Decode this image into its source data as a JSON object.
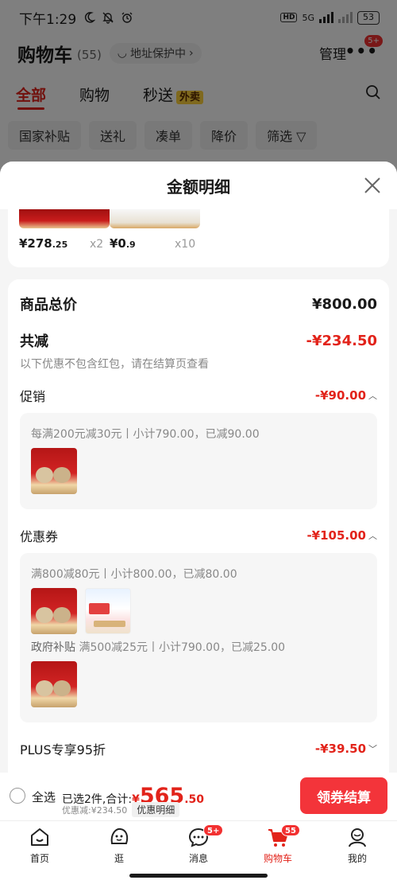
{
  "status_bar": {
    "time": "下午1:29",
    "hd": "HD",
    "network": "5G",
    "battery": "53"
  },
  "cart_header": {
    "title": "购物车",
    "count": "(55)",
    "address_protection": "地址保护中",
    "manage": "管理",
    "more_badge": "5+"
  },
  "tabs": [
    {
      "label": "全部",
      "active": true
    },
    {
      "label": "购物",
      "active": false
    },
    {
      "label": "秒送",
      "active": false,
      "tag": "外卖"
    }
  ],
  "filters": [
    "国家补贴",
    "送礼",
    "凑单",
    "降价",
    "筛选"
  ],
  "sheet": {
    "title": "金额明细",
    "items": [
      {
        "price_int": "¥278",
        "price_dec": ".25",
        "qty": "x2"
      },
      {
        "price_int": "¥0",
        "price_dec": ".9",
        "qty": "x10"
      }
    ],
    "total_label": "商品总价",
    "total_value": "¥800.00",
    "reduce_label": "共减",
    "reduce_value": "-¥234.50",
    "reduce_note": "以下优惠不包含红包，请在结算页查看",
    "promo_label": "促销",
    "promo_value": "-¥90.00",
    "promo_rule": "每满200元减30元丨小计790.00，已减90.00",
    "coupon_label": "优惠券",
    "coupon_value": "-¥105.00",
    "coupon_rule_1": "满800减80元丨小计800.00，已减80.00",
    "coupon_rule_2_tag": "政府补贴",
    "coupon_rule_2": " 满500减25元丨小计790.00，已减25.00",
    "plus_label": "PLUS专享95折",
    "plus_value": "-¥39.50"
  },
  "checkout": {
    "select_all": "全选",
    "selected_prefix": "已选2件,合计:",
    "yen": "¥",
    "total_int": "565",
    "total_dec": ".50",
    "discount_text": "优惠减:¥234.50",
    "detail_button": "优惠明细",
    "checkout_button": "领券结算"
  },
  "bottom_nav": [
    {
      "label": "首页",
      "icon": "home-icon"
    },
    {
      "label": "逛",
      "icon": "explore-face-icon"
    },
    {
      "label": "消息",
      "icon": "message-icon",
      "badge": "5+"
    },
    {
      "label": "购物车",
      "icon": "cart-icon",
      "badge": "55",
      "active": true
    },
    {
      "label": "我的",
      "icon": "profile-icon"
    }
  ],
  "colors": {
    "accent": "#e2231a",
    "checkout_button": "#f3343a",
    "badge": "#f23030"
  }
}
